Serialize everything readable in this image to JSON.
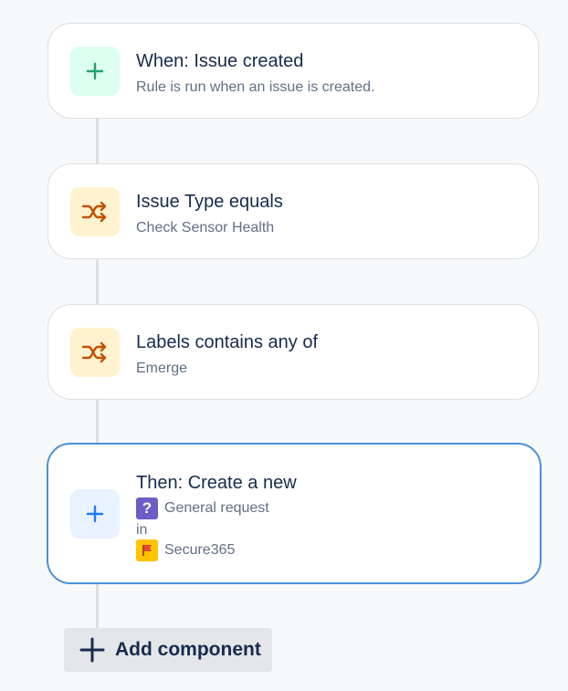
{
  "components": [
    {
      "title": "When: Issue created",
      "subtitle": "Rule is run when an issue is created.",
      "icon": "plus-icon",
      "icon_color": "#22a06b"
    },
    {
      "title": "Issue Type equals",
      "subtitle": "Check Sensor Health",
      "icon": "shuffle-icon",
      "icon_color": "#c25100"
    },
    {
      "title": "Labels contains any of",
      "subtitle": "Emerge",
      "icon": "shuffle-icon",
      "icon_color": "#c25100"
    },
    {
      "title": "Then: Create a new",
      "issue_type": "General request",
      "issue_type_icon": "question-icon",
      "in_label": "in",
      "project": "Secure365",
      "project_icon": "flag-icon",
      "icon": "plus-icon",
      "icon_color": "#1d7afc",
      "selected": true
    }
  ],
  "add_component": {
    "label": "Add component",
    "icon": "plus-icon"
  },
  "colors": {
    "selected_border": "#4a90d9",
    "connector": "#dcdfe4",
    "background": "#f7f8f9"
  }
}
